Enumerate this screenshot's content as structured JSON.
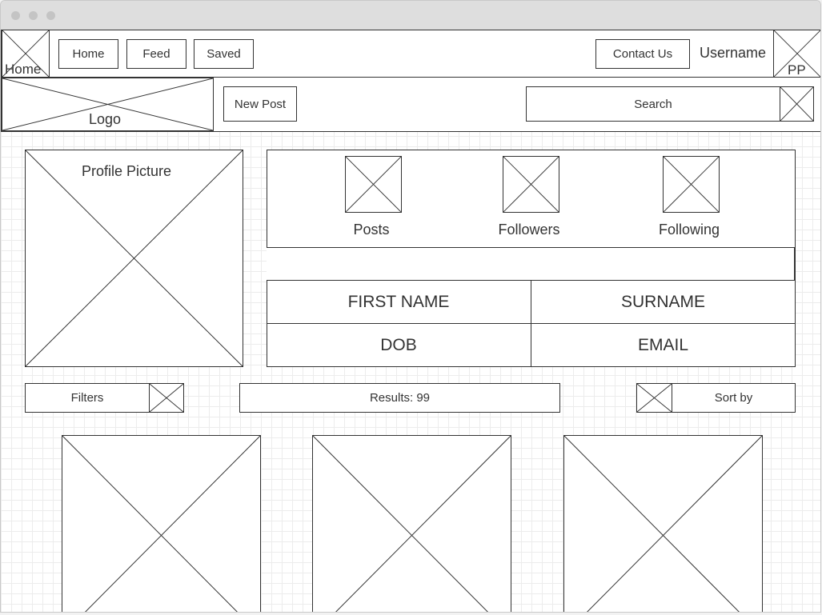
{
  "nav": {
    "home_icon_label": "Home",
    "links": [
      "Home",
      "Feed",
      "Saved"
    ],
    "contact_label": "Contact Us",
    "username": "Username",
    "avatar_label": "PP"
  },
  "toolbar": {
    "logo_label": "Logo",
    "new_post_label": "New Post",
    "search_placeholder": "Search"
  },
  "profile": {
    "picture_label": "Profile Picture",
    "stats": [
      "Posts",
      "Followers",
      "Following"
    ],
    "fields": {
      "first_name": "FIRST NAME",
      "surname": "SURNAME",
      "dob": "DOB",
      "email": "EMAIL"
    }
  },
  "results_bar": {
    "filters_label": "Filters",
    "results_text": "Results: 99",
    "sort_label": "Sort by"
  }
}
